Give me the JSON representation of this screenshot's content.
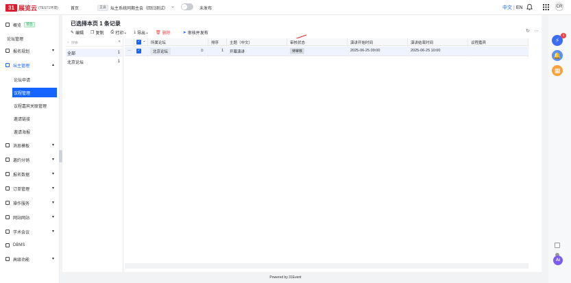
{
  "header": {
    "logo_mark": "31",
    "logo_text": "展览云",
    "env_label": "(TEST1环境)",
    "home": "首页",
    "tag_main": "主会",
    "system_name": "坛主系统同期主会（回归测试）",
    "unpublished": "未发布",
    "lang_cn": "中文",
    "lang_en": "EN",
    "avatar_text": "CR"
  },
  "sidebar": {
    "items": [
      {
        "label": "概览",
        "badge": "预告"
      },
      {
        "label": "论坛管理"
      },
      {
        "label": "报名规划"
      },
      {
        "label": "坛主管理"
      },
      {
        "label": "论坛申请"
      },
      {
        "label": "议程管理"
      },
      {
        "label": "议程嘉宾关联管理"
      },
      {
        "label": "邀请链接"
      },
      {
        "label": "邀请海报"
      },
      {
        "label": "消息模板"
      },
      {
        "label": "邀约分销"
      },
      {
        "label": "报名数据"
      },
      {
        "label": "订单管理"
      },
      {
        "label": "操作服务"
      },
      {
        "label": "网站网站"
      },
      {
        "label": "学术会议"
      },
      {
        "label": "DBMS"
      },
      {
        "label": "高级功能"
      }
    ]
  },
  "main": {
    "title": "已选择本页 1 条记录",
    "toolbar": {
      "edit": "编辑",
      "copy": "复制",
      "print": "打印",
      "export": "导出",
      "delete": "删除",
      "publish": "审核并发布"
    },
    "tree": {
      "search_placeholder": "搜索",
      "rows": [
        {
          "label": "全部",
          "count": "1"
        },
        {
          "label": "北京论坛",
          "count": "1"
        }
      ]
    },
    "table": {
      "headers": [
        "所属论坛",
        "排序",
        "主题（中文）",
        "审核状态",
        "演讲开始时间",
        "演讲结束时间",
        "议程嘉宾"
      ],
      "rows": [
        {
          "forum": "北京论坛",
          "order": "1",
          "topic": "开幕演讲",
          "status": "待审核",
          "start": "2025-06-25 09:00",
          "end": "2025-06-25 10:00",
          "guest": ""
        }
      ]
    }
  },
  "footer": {
    "text": "Powered by 31Event"
  },
  "rightbar": {
    "badge_count": "1",
    "ai_label": "Ai"
  },
  "colors": {
    "accent": "#1664ff",
    "brand": "#d81e2b",
    "danger": "#f53f3f"
  }
}
